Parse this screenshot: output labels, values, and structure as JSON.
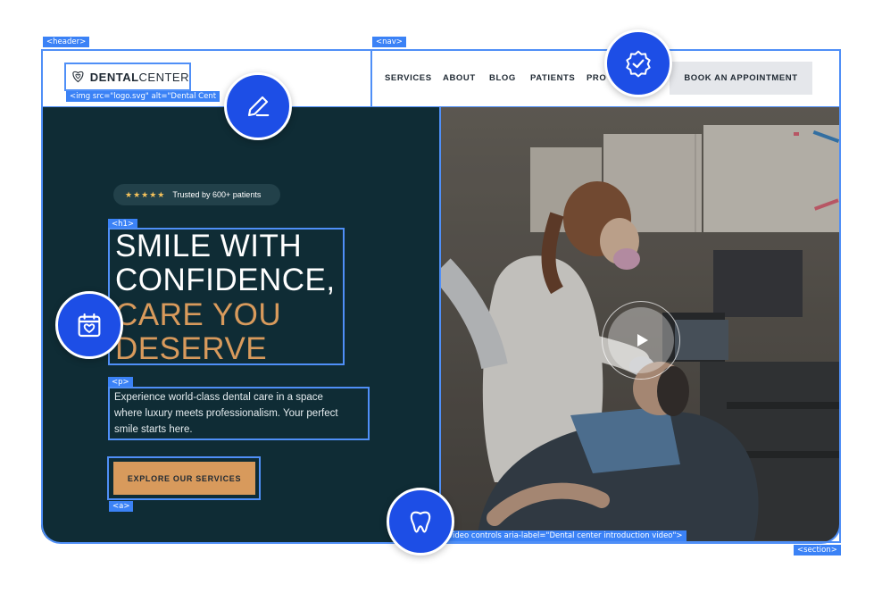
{
  "dev_tags": {
    "header": "<header>",
    "nav": "<nav>",
    "img": "<img src=\"logo.svg\" alt=\"Dental Cent",
    "h1": "<h1>",
    "p": "<p>",
    "a": "<a>",
    "video": "video controls aria-label=\"Dental center introduction video\">",
    "section": "<section>"
  },
  "logo": {
    "bold": "DENTAL",
    "light": "CENTER",
    "icon": "heart-tooth-icon"
  },
  "nav": {
    "items": [
      "SERVICES",
      "ABOUT",
      "BLOG",
      "PATIENTS",
      "PRO"
    ],
    "cta": "BOOK AN APPOINTMENT"
  },
  "hero": {
    "stars": "★★★★★",
    "trust": "Trusted by 600+ patients",
    "heading": {
      "line1": "SMILE WITH",
      "line2": "CONFIDENCE,",
      "line3": "CARE YOU",
      "line4": "DESERVE"
    },
    "paragraph": {
      "line1": "Experience world-class dental care in a space",
      "line2": "where luxury meets professionalism. Your perfect",
      "line3": "smile starts here."
    },
    "cta": "EXPLORE OUR SERVICES"
  },
  "video": {
    "icon": "play-icon"
  },
  "floating_badges": [
    "pencil-icon",
    "verified-badge-icon",
    "calendar-heart-icon",
    "tooth-icon"
  ],
  "colors": {
    "primary_dark": "#0f2c35",
    "accent_gold": "#d89a5c",
    "outline_blue": "#4f8ff7",
    "badge_blue": "#1d4ee6"
  }
}
